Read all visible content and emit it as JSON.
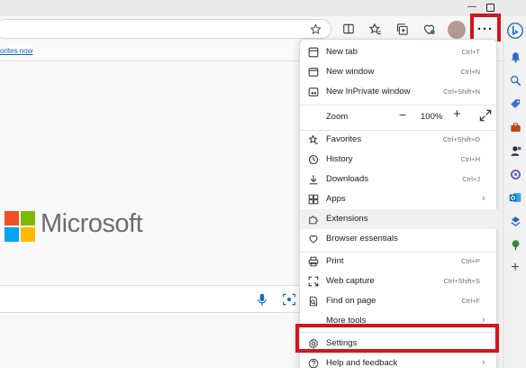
{
  "favorites_bar": {
    "link_text": "orites now"
  },
  "menu": {
    "items": [
      {
        "label": "New tab",
        "shortcut": "Ctrl+T"
      },
      {
        "label": "New window",
        "shortcut": "Ctrl+N"
      },
      {
        "label": "New InPrivate window",
        "shortcut": "Ctrl+Shift+N"
      },
      {
        "label": "Zoom",
        "value": "100%"
      },
      {
        "label": "Favorites",
        "shortcut": "Ctrl+Shift+O"
      },
      {
        "label": "History",
        "shortcut": "Ctrl+H"
      },
      {
        "label": "Downloads",
        "shortcut": "Ctrl+J"
      },
      {
        "label": "Apps"
      },
      {
        "label": "Extensions"
      },
      {
        "label": "Browser essentials"
      },
      {
        "label": "Print",
        "shortcut": "Ctrl+P"
      },
      {
        "label": "Web capture",
        "shortcut": "Ctrl+Shift+S"
      },
      {
        "label": "Find on page",
        "shortcut": "Ctrl+F"
      },
      {
        "label": "More tools"
      },
      {
        "label": "Settings"
      },
      {
        "label": "Help and feedback"
      }
    ]
  },
  "page": {
    "brand_text": "Microsoft"
  },
  "toolbar": {
    "more_label": "···"
  },
  "colors": {
    "highlight_box": "#d2151b",
    "accent": "#0f6cbd",
    "ms_red": "#f25022",
    "ms_green": "#7fba00",
    "ms_blue": "#00a4ef",
    "ms_yellow": "#ffb900"
  }
}
